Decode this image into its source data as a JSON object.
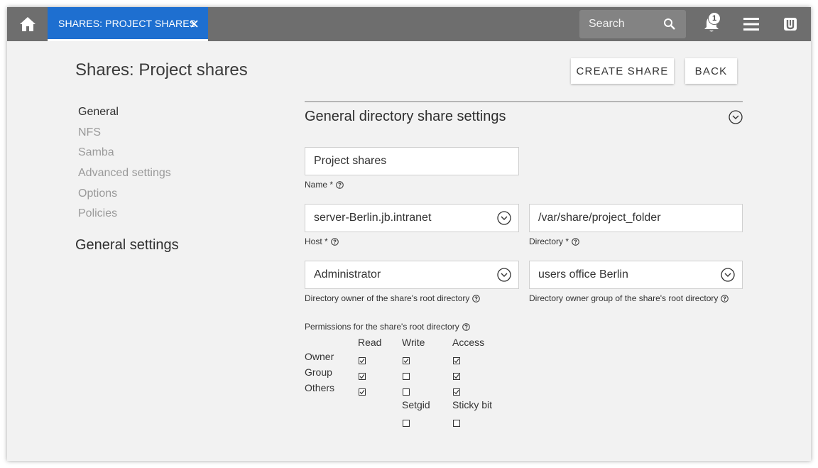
{
  "topbar": {
    "tab_label": "SHARES: PROJECT SHARES",
    "search_placeholder": "Search",
    "notification_count": "1"
  },
  "header": {
    "title": "Shares: Project shares",
    "create_label": "CREATE SHARE",
    "back_label": "BACK"
  },
  "nav": {
    "items": [
      {
        "label": "General"
      },
      {
        "label": "NFS"
      },
      {
        "label": "Samba"
      },
      {
        "label": "Advanced settings"
      },
      {
        "label": "Options"
      },
      {
        "label": "Policies"
      }
    ],
    "section": "General settings"
  },
  "panel": {
    "title": "General directory share settings",
    "name": {
      "value": "Project shares",
      "label": "Name *"
    },
    "host": {
      "value": "server-Berlin.jb.intranet",
      "label": "Host *"
    },
    "directory": {
      "value": "/var/share/project_folder",
      "label": "Directory *"
    },
    "owner": {
      "value": "Administrator",
      "label": "Directory owner of the share's root directory"
    },
    "group": {
      "value": "users office Berlin",
      "label": "Directory owner group of the share's root directory"
    }
  },
  "permissions": {
    "title": "Permissions for the share's root directory",
    "columns": [
      "Read",
      "Write",
      "Access"
    ],
    "rows": [
      {
        "label": "Owner",
        "values": [
          true,
          true,
          true
        ]
      },
      {
        "label": "Group",
        "values": [
          true,
          false,
          true
        ]
      },
      {
        "label": "Others",
        "values": [
          true,
          false,
          true
        ]
      }
    ],
    "extra_labels": [
      "Setgid",
      "Sticky bit"
    ],
    "extra_values": [
      false,
      false
    ]
  }
}
